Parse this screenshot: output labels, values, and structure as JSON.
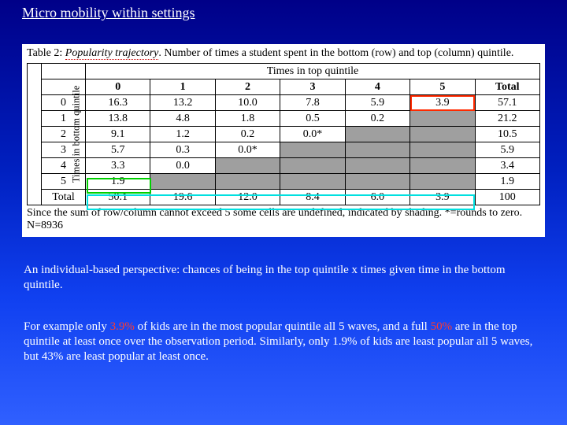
{
  "title": "Micro mobility within settings",
  "table": {
    "caption_prefix": "Table 2: ",
    "caption_ital": "Popularity trajectory",
    "caption_rest": ".  Number of times a student spent in the bottom (row) and top (column) quintile.",
    "col_group_label": "Times in top quintile",
    "row_group_label": "Times in bottom quintile",
    "col_headers": [
      "0",
      "1",
      "2",
      "3",
      "4",
      "5",
      "Total"
    ],
    "row_headers": [
      "0",
      "1",
      "2",
      "3",
      "4",
      "5",
      "Total"
    ],
    "cells": [
      [
        "16.3",
        "13.2",
        "10.0",
        "7.8",
        "5.9",
        "3.9",
        "57.1"
      ],
      [
        "13.8",
        "4.8",
        "1.8",
        "0.5",
        "0.2",
        "",
        "21.2"
      ],
      [
        "9.1",
        "1.2",
        "0.2",
        "0.0*",
        "",
        "",
        "10.5"
      ],
      [
        "5.7",
        "0.3",
        "0.0*",
        "",
        "",
        "",
        "5.9"
      ],
      [
        "3.3",
        "0.0",
        "",
        "",
        "",
        "",
        "3.4"
      ],
      [
        "1.9",
        "",
        "",
        "",
        "",
        "",
        "1.9"
      ],
      [
        "50.1",
        "19.6",
        "12.0",
        "8.4",
        "6.0",
        "3.9",
        "100"
      ]
    ],
    "footnote": "Since the sum of row/column cannot exceed 5 some cells are undefined, indicated by shading.  *=rounds to zero.  N=8936"
  },
  "para1": "An individual-based perspective: chances of being in the top quintile x times given time in the bottom quintile.",
  "para2_a": "For example only ",
  "para2_b": "3.9%",
  "para2_c": " of kids are in the most popular quintile all 5 waves, and a full ",
  "para2_d": "50%",
  "para2_e": " are in the top quintile at least once over the observation period.  Similarly, only 1.9% of kids are least popular all 5 waves, but 43% are least popular at least once."
}
